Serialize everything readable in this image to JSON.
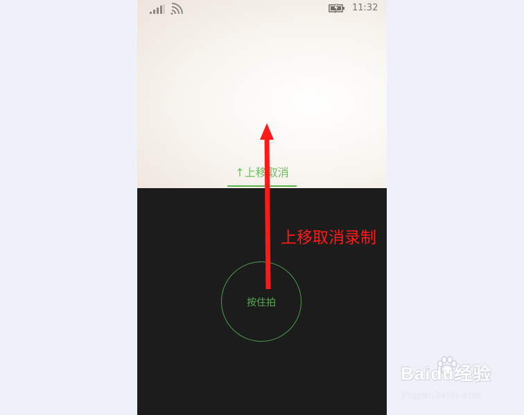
{
  "status_bar": {
    "time": "11:32",
    "signal_icon": "signal-bars-icon",
    "wifi_icon": "wifi-icon",
    "battery_icon": "battery-charging-icon"
  },
  "camera": {
    "swipe_hint": "↑上移取消"
  },
  "recorder": {
    "record_button_label": "按住拍"
  },
  "annotation": {
    "text": "上移取消录制",
    "arrow_icon": "arrow-up-icon",
    "color": "#ff1a1a"
  },
  "watermark": {
    "brand": "Baidu经验",
    "url": "jingyan.baidu.com"
  },
  "colors": {
    "accent_green": "#57b349",
    "recorder_background": "#1c1c1c"
  }
}
